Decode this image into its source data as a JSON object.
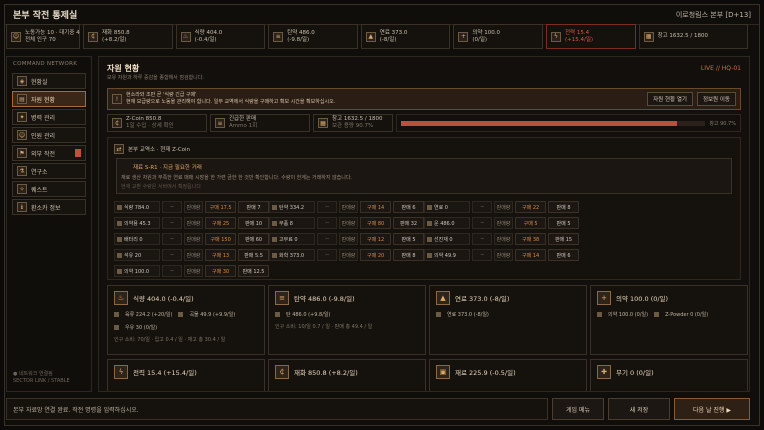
{
  "header": {
    "title": "본부 작전 통제실",
    "right": "이로청림스 본부 [D+13]"
  },
  "resources_top": [
    {
      "icon": "person-icon",
      "l1": "노동가능 10 · 대기중 4",
      "l2": "전체 인구 70"
    },
    {
      "icon": "coin-icon",
      "l1": "재화 850.8",
      "l2": "(+8.2/일)"
    },
    {
      "icon": "food-icon",
      "l1": "식량 404.0",
      "l2": "(-0.4/일)"
    },
    {
      "icon": "ammo-icon",
      "l1": "탄약 486.0",
      "l2": "(-9.8/일)"
    },
    {
      "icon": "fuel-icon",
      "l1": "연료 373.0",
      "l2": "(-8/일)"
    },
    {
      "icon": "medicine-icon",
      "l1": "의약 100.0",
      "l2": "(0/일)"
    },
    {
      "icon": "power-icon",
      "l1": "전력 15.4",
      "l2": "(+15.4/일)",
      "alert": true
    },
    {
      "icon": "warehouse-icon",
      "l1": "창고 1632.5 / 1800",
      "l2": ""
    }
  ],
  "sidebar": {
    "title": "COMMAND NETWORK",
    "items": [
      {
        "label": "현황실",
        "icon": "map-icon"
      },
      {
        "label": "자원 현황",
        "icon": "resource-icon",
        "active": true
      },
      {
        "label": "병력 관리",
        "icon": "troops-icon"
      },
      {
        "label": "인원 관리",
        "icon": "people-icon"
      },
      {
        "label": "외부 작전",
        "icon": "mission-icon",
        "badge": true
      },
      {
        "label": "연구소",
        "icon": "lab-icon"
      },
      {
        "label": "퀘스트",
        "icon": "quest-icon"
      },
      {
        "label": "환소카 정보",
        "icon": "info-icon"
      }
    ],
    "footer1": "● 네트워크 연결됨",
    "footer2": "SECTOR LINK / STABLE"
  },
  "main": {
    "title": "자원 현황",
    "subtitle": "보유 자원과 하루 증감을 종합해서 점검합니다.",
    "live": "LIVE // HQ-01",
    "alert": {
      "text1": "현소라와 조만 곧 '식량 긴급 구매'",
      "text2": "현재 보급량으로 노동을 관리해야 합니다. 일부 교역에서 식량을 구매하고 확보 시간을 확보하십시오.",
      "btn1": "자원 현황 열기",
      "btn2": "정보원 이동"
    },
    "cap": {
      "coin": "Z-Coin 850.8",
      "coin_sub": "1일 수입 · 상세 확인",
      "ammo": "긴급한 판매",
      "ammo_sub": "Ammo 1회",
      "warehouse": "창고 1632.5 / 1800",
      "warehouse_sub": "보관 용량 90.7%",
      "pct": "창고 90.7%",
      "fill": 0.907
    },
    "exchange": {
      "title": "본부 교역소 · 현재 Z-Coin",
      "note1": "재료 S-R1 · 지금 필요한 거래",
      "note2": "재료 생산 자원과 부족한 연료 매매 시장을 한 가련 금한 한 것만 확인합니다. 수량이 한계는 거래하지 않습니다.",
      "note3": "현재 교환 수량은 서버에서 확정됩니다"
    },
    "exchange_rows": [
      [
        [
          "식량 784.0",
          "--",
          "판매량",
          "구매 17.5",
          "판매 7"
        ],
        [
          "탄약 334.2",
          "--",
          "판매량",
          "구매 14",
          "판매 6"
        ],
        [
          "연료 0",
          "--",
          "판매량",
          "구매 22",
          "판매 8"
        ]
      ],
      [
        [
          "의약용 45.3",
          "--",
          "판매량",
          "구매 25",
          "판매 10"
        ],
        [
          "부품 8",
          "--",
          "판매량",
          "구매 80",
          "판매 32"
        ],
        [
          "운 486.0",
          "--",
          "판매량",
          "구매 5",
          "판매 5"
        ]
      ],
      [
        [
          "배터리 0",
          "--",
          "판매량",
          "구매 150",
          "판매 60"
        ],
        [
          "고무료 0",
          "--",
          "판매량",
          "구매 12",
          "판매 5"
        ],
        [
          "선진재 0",
          "--",
          "판매량",
          "구매 38",
          "판매 15"
        ]
      ],
      [
        [
          "석유 20",
          "--",
          "판매량",
          "구매 13",
          "판매 5.5"
        ],
        [
          "화학 373.0",
          "--",
          "판매량",
          "구매 20",
          "판매 8"
        ],
        [
          "의약 49.9",
          "--",
          "판매량",
          "구매 14",
          "판매 6"
        ]
      ],
      [
        [
          "의약 100.0",
          "--",
          "판매량",
          "구매 30",
          "판매 12.5"
        ]
      ]
    ],
    "cards": [
      {
        "icon": "food-icon",
        "name": "식량 404.0 (-0.4/일)",
        "l1a": "육류 224.2 (+20/일)",
        "l1b": "곡물 49.9 (+9.9/일)",
        "l2": "우유 30 (0/일)",
        "foot": "인구 소비: 70/일 · 입고 0.4 / 일 · 재고 총 30.4 / 일"
      },
      {
        "icon": "ammo-icon",
        "name": "탄약 486.0 (-9.8/일)",
        "l1a": "탄 486.0 (+9.8/일)",
        "l1b": "",
        "l2": "",
        "foot": "인구 소비: 10/일 0.7 / 일 · 판매 총 49.4 / 일"
      },
      {
        "icon": "fuel-icon",
        "name": "연료 373.0 (-8/일)",
        "l1a": "연료 373.0 (-8/일)",
        "l1b": "",
        "l2": "",
        "foot": ""
      },
      {
        "icon": "medicine-icon",
        "name": "의약 100.0 (0/일)",
        "l1a": "의약 100.0 (0/일)",
        "l1b": "Z-Powder 0 (0/일)",
        "l2": "",
        "foot": ""
      },
      {
        "icon": "power-icon",
        "name": "전력 15.4 (+15.4/일)",
        "l1a": "",
        "l1b": "",
        "l2": "",
        "foot": ""
      },
      {
        "icon": "coin-icon",
        "name": "재화 850.8 (+8.2/일)",
        "l1a": "",
        "l1b": "",
        "l2": "",
        "foot": ""
      },
      {
        "icon": "material-icon",
        "name": "재료 225.9 (-0.5/일)",
        "l1a": "",
        "l1b": "",
        "l2": "",
        "foot": ""
      },
      {
        "icon": "weapon-icon",
        "name": "무기 0 (0/일)",
        "l1a": "",
        "l1b": "",
        "l2": "",
        "foot": ""
      }
    ]
  },
  "footer": {
    "message": "본부 자료망 연결 완료. 작전 명령을 입력하십시오.",
    "btn_menu": "게임 메뉴",
    "btn_save": "새 저장",
    "btn_next": "다음 날 진행 ▶"
  }
}
